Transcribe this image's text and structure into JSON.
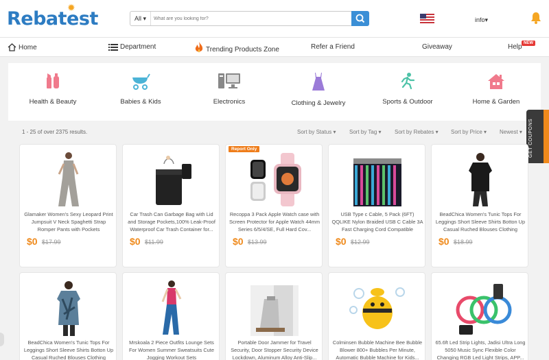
{
  "header": {
    "logo_text": "Rebatest",
    "search_category": "All",
    "search_placeholder": "What are you looking for?",
    "account_label": "info"
  },
  "nav": {
    "home": "Home",
    "department": "Department",
    "trending": "Trending Products Zone",
    "refer": "Refer a Friend",
    "giveaway": "Giveaway",
    "help": "Help",
    "help_badge": "NEW"
  },
  "categories": [
    {
      "label": "Health & Beauty",
      "icon": "lipstick-icon",
      "color": "#f07a8c"
    },
    {
      "label": "Babies & Kids",
      "icon": "stroller-icon",
      "color": "#4bb3d6"
    },
    {
      "label": "Electronics",
      "icon": "computer-icon",
      "color": "#888888"
    },
    {
      "label": "Clothing & Jewelry",
      "icon": "dress-icon",
      "color": "#9b7bd8"
    },
    {
      "label": "Sports & Outdoor",
      "icon": "runner-icon",
      "color": "#4cc2a7"
    },
    {
      "label": "Home & Garden",
      "icon": "house-icon",
      "color": "#f07a8c"
    }
  ],
  "results": {
    "count_text": "1 - 25 of over 2375 results.",
    "sorts": [
      "Sort by Status",
      "Sort by Tag",
      "Sort by Rebates",
      "Sort by Price",
      "Newest"
    ]
  },
  "coupons_label": "GET COUPONS",
  "report_badge": "Report Only",
  "products": [
    {
      "title": "Glamaker Women's Sexy Leopard Print Jumpsuit V Neck Spaghetti Strap Romper Pants with Pockets",
      "price": "$0",
      "old_price": "$17.99"
    },
    {
      "title": "Car Trash Can Garbage Bag with Lid and Storage Pockets,100% Leak-Proof Waterproof Car Trash Container for...",
      "price": "$0",
      "old_price": "$11.99"
    },
    {
      "title": "Recoppa 3 Pack Apple Watch case with Screen Protector for Apple Watch 44mm Series 6/5/4/SE, Full Hard Cov...",
      "price": "$0",
      "old_price": "$13.99"
    },
    {
      "title": "USB Type c Cable, 5 Pack (6FT) QQLIKE Nylon Braided USB C Cable 3A Fast Charging Cord Compatible Samsung...",
      "price": "$0",
      "old_price": "$12.99"
    },
    {
      "title": "BeadChica Women's Tunic Tops For Leggings Short Sleeve Shirts Botton Up Casual Ruched Blouses Clothing",
      "price": "$0",
      "old_price": "$18.99"
    },
    {
      "title": "BeadChica Women's Tunic Tops For Leggings Short Sleeve Shirts Botton Up Casual Ruched Blouses Clothing",
      "price": "",
      "old_price": ""
    },
    {
      "title": "Mrskoala 2 Piece Outfits Lounge Sets For Women Summer Sweatsuits Cute Jogging Workout Sets",
      "price": "",
      "old_price": ""
    },
    {
      "title": "Portable Door Jammer for Travel Security, Door Stopper Security Device Lockdown, Aluminum Alloy Anti-Slip...",
      "price": "",
      "old_price": ""
    },
    {
      "title": "Colminsen Bubble Machine Bee Bubble Blower 800+ Bubbles Per Minute, Automatic Bubble Machine for Kids...",
      "price": "",
      "old_price": ""
    },
    {
      "title": "65.6ft Led Strip Lights, Jadisi Ultra Long 5050 Music Sync Flexible Color Changing RGB Led Light Strips, APP...",
      "price": "",
      "old_price": ""
    }
  ],
  "colors": {
    "accent": "#ef8a1c",
    "brand": "#2d7cc2",
    "search_button": "#3b8fd6"
  }
}
